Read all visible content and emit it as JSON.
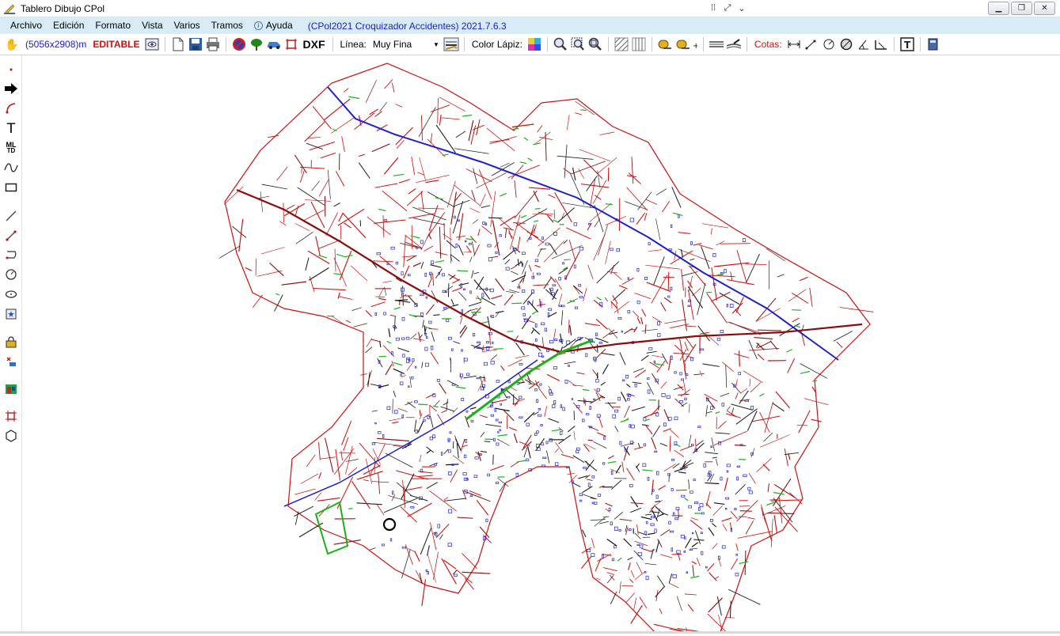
{
  "window": {
    "title": "Tablero Dibujo CPol"
  },
  "menu": {
    "items": [
      "Archivo",
      "Edición",
      "Formato",
      "Vista",
      "Varios",
      "Tramos"
    ],
    "help": "Ayuda",
    "version": "(CPol2021 Croquizador Accidentes) 2021.7.6.3"
  },
  "toolbar": {
    "dimensions": "(5056x2908)m",
    "editable": "EDITABLE",
    "dxf": "DXF",
    "line_label": "Línea:",
    "line_value": "Muy Fina",
    "color_label": "Color Lápiz:",
    "cotas_label": "Cotas:",
    "text_tool": "T"
  },
  "sidebar": {
    "text_tool": "T",
    "ml_tool": "ML"
  },
  "colors": {
    "menubar": "#d8ecf8",
    "accent_blue": "#1a1ad8",
    "accent_red": "#d01010",
    "map_red": "#cc1111",
    "map_blue": "#1f1fd0",
    "map_green": "#19b319"
  }
}
